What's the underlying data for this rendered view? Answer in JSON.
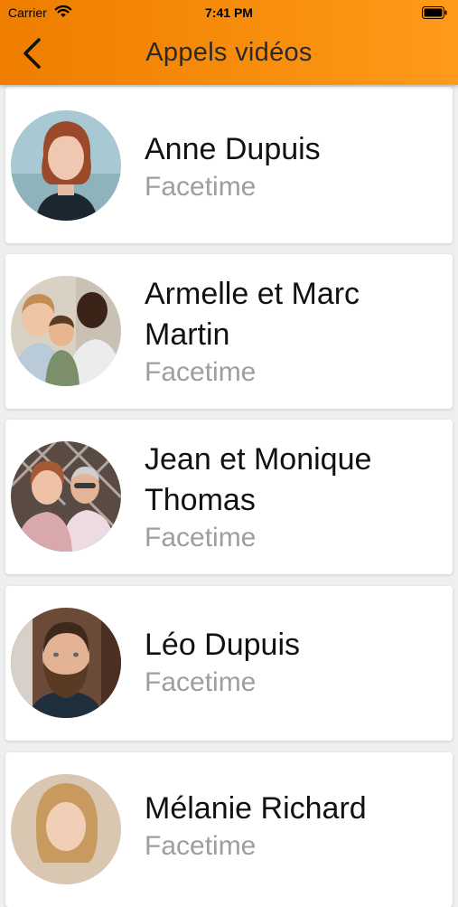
{
  "status_bar": {
    "carrier": "Carrier",
    "time": "7:41 PM"
  },
  "header": {
    "title": "Appels vidéos",
    "back_icon": "chevron-left-icon",
    "accent": "#f58a0a"
  },
  "contacts": [
    {
      "name": "Anne Dupuis",
      "subtitle": "Facetime"
    },
    {
      "name": "Armelle et Marc Martin",
      "subtitle": "Facetime"
    },
    {
      "name": "Jean et Monique Thomas",
      "subtitle": "Facetime"
    },
    {
      "name": "Léo Dupuis",
      "subtitle": "Facetime"
    },
    {
      "name": "Mélanie Richard",
      "subtitle": "Facetime"
    }
  ]
}
